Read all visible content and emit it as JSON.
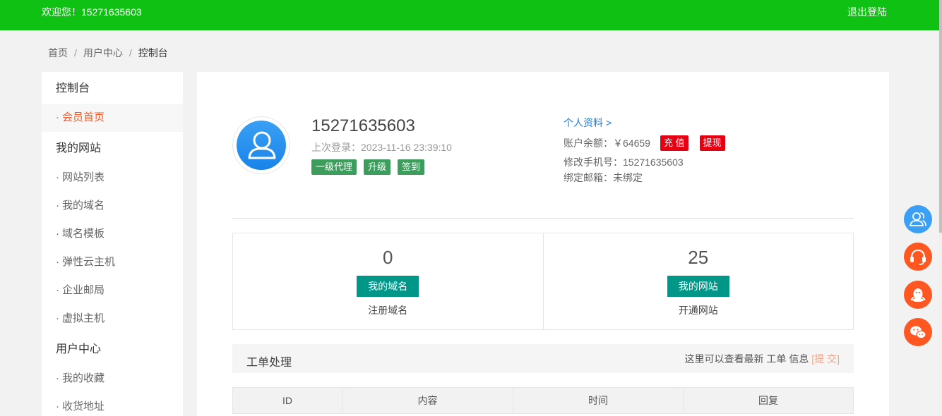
{
  "header": {
    "welcome": "欢迎您！15271635603",
    "logout": "退出登陆"
  },
  "breadcrumb": [
    "首页",
    "用户中心",
    "控制台"
  ],
  "sidebar": {
    "sections": [
      {
        "title": "控制台",
        "items": [
          "会员首页"
        ]
      },
      {
        "title": "我的网站",
        "items": [
          "网站列表",
          "我的域名",
          "域名模板",
          "弹性云主机",
          "企业邮局",
          "虚拟主机"
        ]
      },
      {
        "title": "用户中心",
        "items": [
          "我的收藏",
          "收货地址"
        ]
      }
    ],
    "active_item": "会员首页"
  },
  "profile": {
    "username": "15271635603",
    "last_login": "上次登录：2023-11-16 23:39:10",
    "tags": [
      "一级代理",
      "升级",
      "签到"
    ],
    "profile_link": "个人资料 >",
    "balance_label": "账户余额：￥64659",
    "recharge": "充 值",
    "withdraw": "提现",
    "phone": "修改手机号：15271635603",
    "email": "绑定邮箱：未绑定"
  },
  "stats": [
    {
      "value": "0",
      "button": "我的域名",
      "label": "注册域名"
    },
    {
      "value": "25",
      "button": "我的网站",
      "label": "开通网站"
    }
  ],
  "tickets": {
    "title": "工单处理",
    "hint": "这里可以查看最新 工单 信息",
    "submit": "[提 交]",
    "columns": [
      "ID",
      "内容",
      "时间",
      "回复"
    ]
  },
  "float_buttons": [
    {
      "icon": "user-service-icon",
      "color": "#3a9ff5"
    },
    {
      "icon": "headset-icon",
      "color": "#ff5722"
    },
    {
      "icon": "qq-icon",
      "color": "#ff5722"
    },
    {
      "icon": "wechat-icon",
      "color": "#ff5722"
    }
  ]
}
